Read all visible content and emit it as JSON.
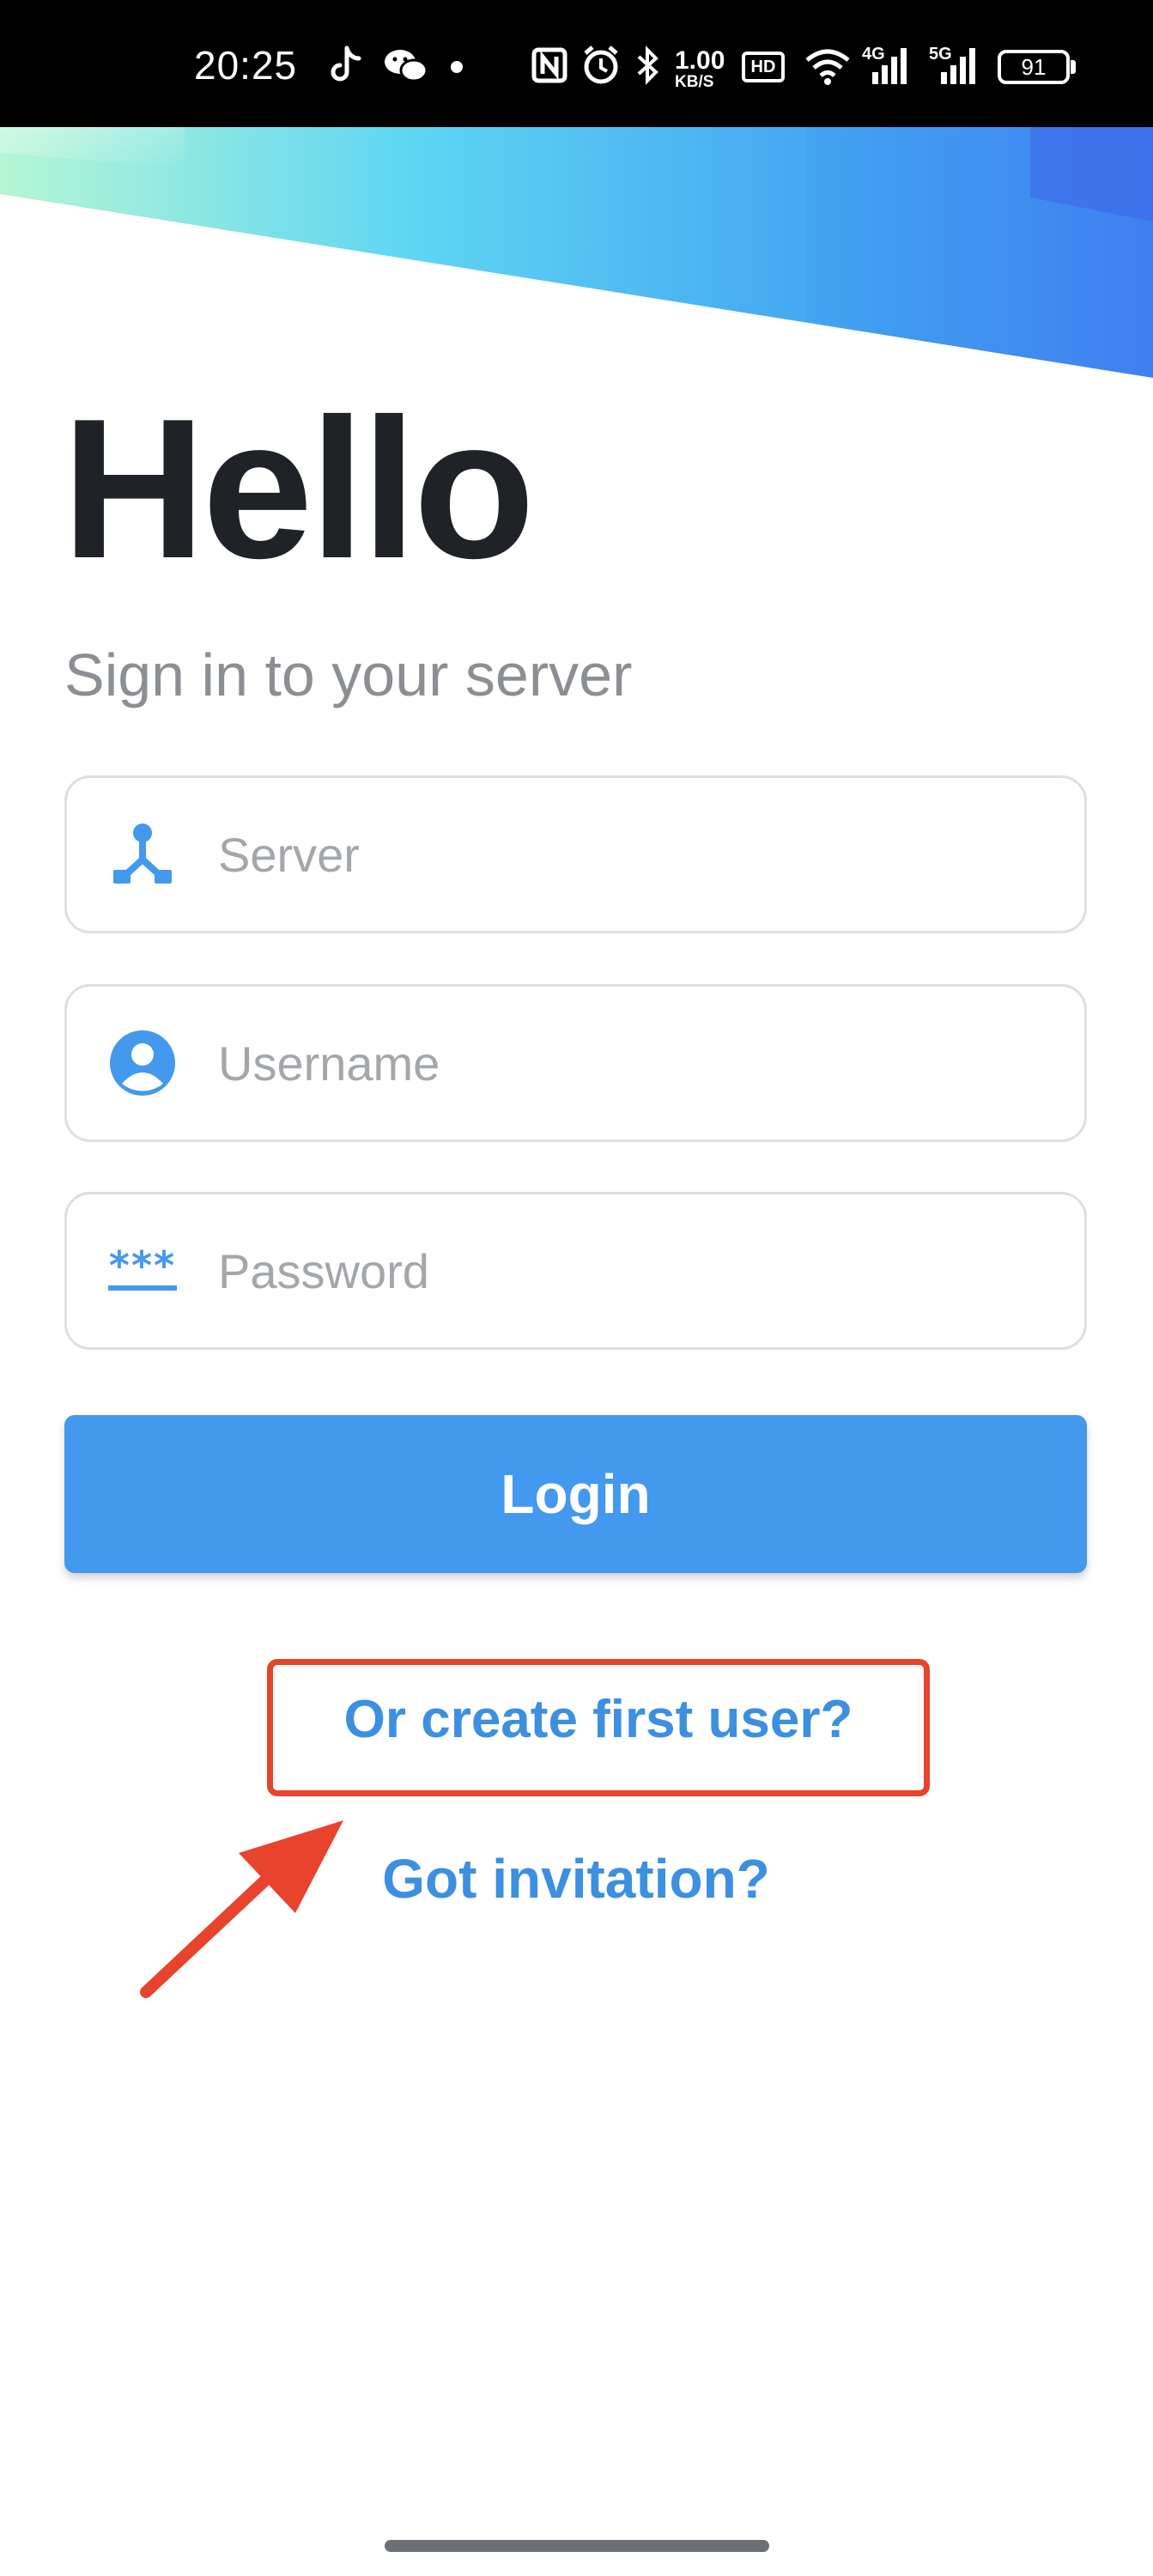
{
  "status_bar": {
    "time": "20:25",
    "net_speed_value": "1.00",
    "net_speed_unit": "KB/S",
    "hd_label": "HD",
    "signal1_label": "4G",
    "signal2_label": "5G",
    "battery": "91",
    "icons": [
      "tiktok-icon",
      "wechat-icon",
      "dot-icon",
      "nfc-icon",
      "alarm-icon",
      "bluetooth-icon",
      "hd-icon",
      "wifi-icon",
      "signal-4g-icon",
      "signal-5g-icon",
      "battery-icon"
    ]
  },
  "header": {
    "title": "Hello",
    "subtitle": "Sign in to your server"
  },
  "form": {
    "server": {
      "placeholder": "Server",
      "value": "",
      "icon": "server-icon"
    },
    "username": {
      "placeholder": "Username",
      "value": "",
      "icon": "user-icon"
    },
    "password": {
      "placeholder": "Password",
      "value": "",
      "icon": "password-icon",
      "icon_text": "***"
    },
    "login_label": "Login"
  },
  "links": {
    "create_first_user": "Or create first user?",
    "got_invitation": "Got invitation?"
  },
  "colors": {
    "accent": "#4299ed",
    "link": "#3d8fe0",
    "annotation": "#e8432c",
    "title": "#1f2226",
    "subtitle": "#8b8f94"
  }
}
